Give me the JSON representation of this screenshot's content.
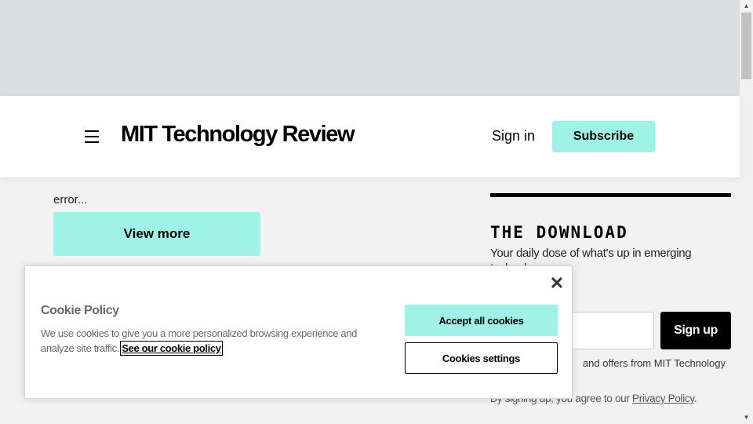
{
  "header": {
    "logo": "MIT Technology Review",
    "sign_in": "Sign in",
    "subscribe": "Subscribe"
  },
  "main": {
    "snippet_tail": "error...",
    "view_more": "View more"
  },
  "newsletter": {
    "title": "THE DOWNLOAD",
    "description": "Your daily dose of what's up in emerging technology",
    "email_placeholder": "",
    "sign_up": "Sign up",
    "offers_text": "and offers from MIT Technology",
    "agree_prefix": "By signing up, you agree to our ",
    "privacy_link": "Privacy Policy",
    "agree_suffix": "."
  },
  "cookie_banner": {
    "title": "Cookie Policy",
    "text": "We use cookies to give you a more personalized browsing experience and analyze site traffic. ",
    "link": "See our cookie policy",
    "accept": "Accept all cookies",
    "settings": "Cookies settings",
    "close_icon": "close-icon"
  },
  "scrollbar": {
    "up_icon": "scroll-up-arrow-icon",
    "down_icon": "scroll-down-arrow-icon"
  },
  "colors": {
    "accent": "#9ef2e6",
    "ad_band": "#dcdddf",
    "page_bg": "#f2f2f2",
    "black": "#000000"
  }
}
